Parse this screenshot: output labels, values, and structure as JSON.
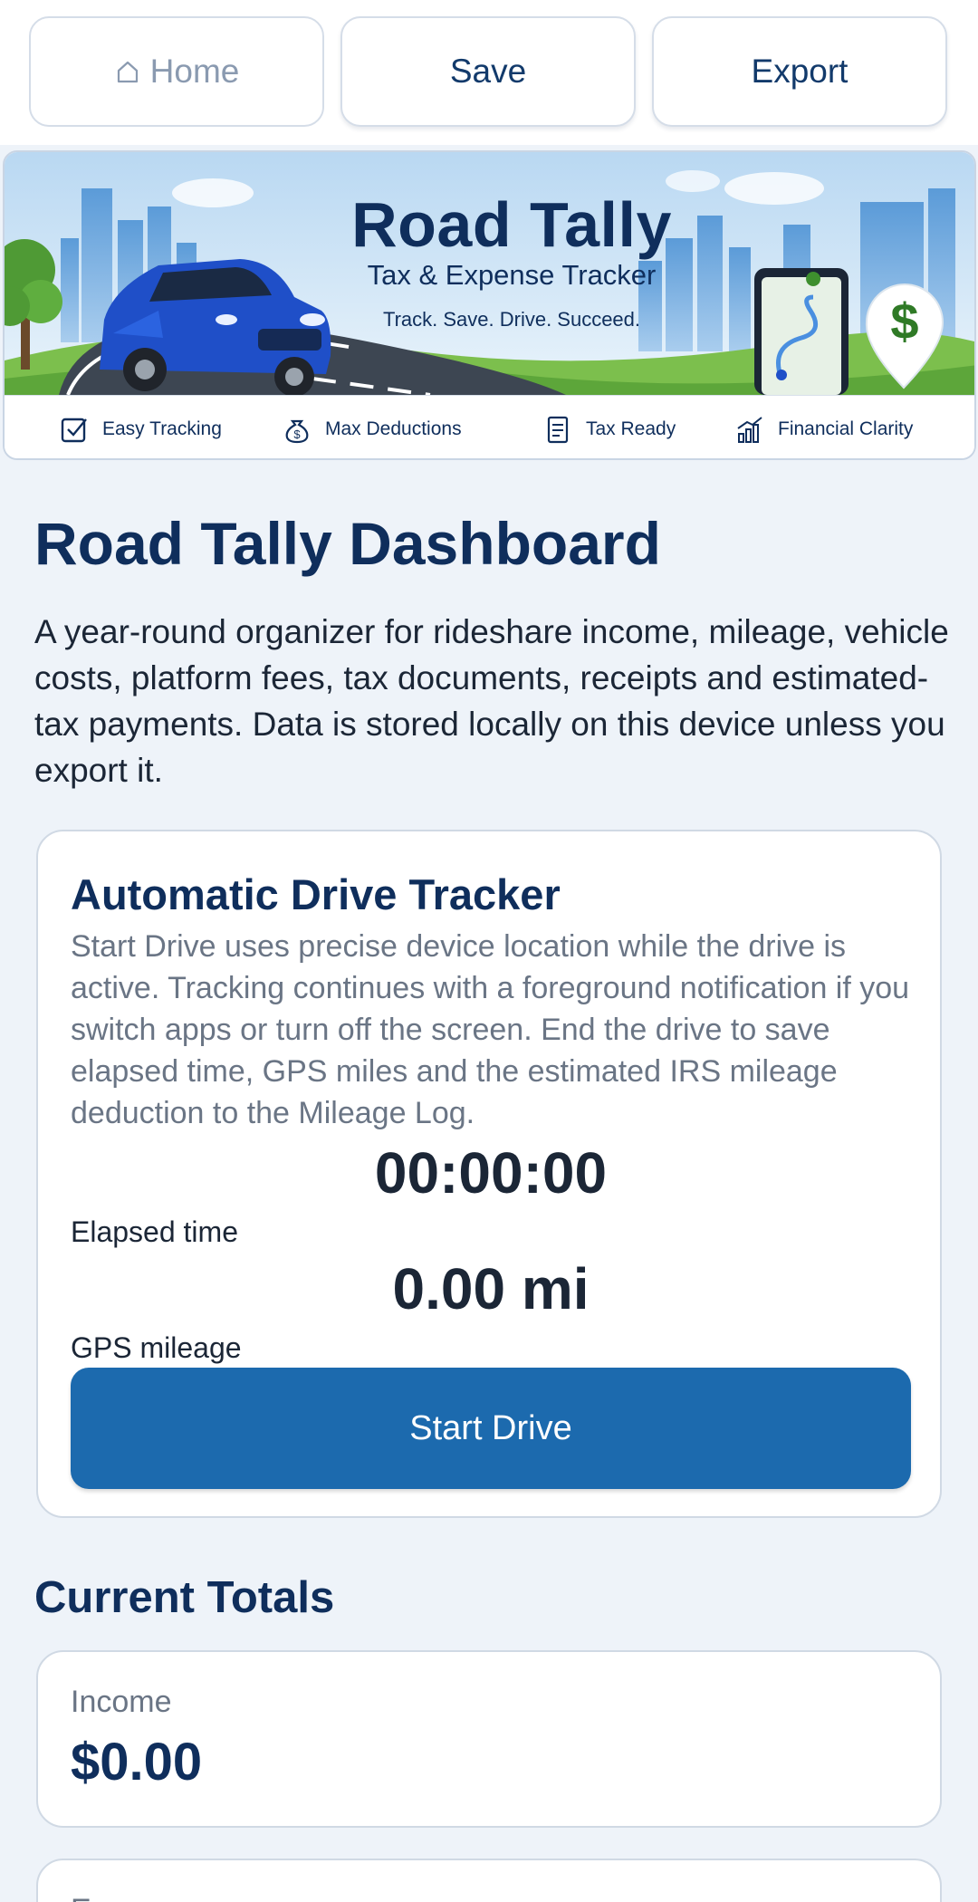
{
  "nav": {
    "home_label": "Home",
    "save_label": "Save",
    "export_label": "Export"
  },
  "banner": {
    "title": "Road Tally",
    "subtitle": "Tax & Expense Tracker",
    "tagline": "Track. Save. Drive. Succeed.",
    "features": [
      {
        "label": "Easy Tracking",
        "icon": "checkbox-icon"
      },
      {
        "label": "Max Deductions",
        "icon": "money-bag-icon"
      },
      {
        "label": "Tax Ready",
        "icon": "document-icon"
      },
      {
        "label": "Financial Clarity",
        "icon": "growth-chart-icon"
      }
    ],
    "pin_symbol": "$"
  },
  "page": {
    "title": "Road Tally Dashboard",
    "intro": "A year-round organizer for rideshare income, mileage, vehicle costs, platform fees, tax documents, receipts and estimated-tax payments. Data is stored locally on this device unless you export it."
  },
  "tracker": {
    "title": "Automatic Drive Tracker",
    "description": "Start Drive uses precise device location while the drive is active. Tracking continues with a foreground notification if you switch apps or turn off the screen. End the drive to save elapsed time, GPS miles and the estimated IRS mileage deduction to the Mileage Log.",
    "elapsed_value": "00:00:00",
    "elapsed_label": "Elapsed time",
    "miles_value": "0.00 mi",
    "miles_label": "GPS mileage",
    "start_label": "Start Drive"
  },
  "totals": {
    "title": "Current Totals",
    "items": [
      {
        "label": "Income",
        "value": "$0.00"
      },
      {
        "label": "E",
        "value": ""
      }
    ]
  },
  "colors": {
    "primary": "#1c6aae",
    "heading": "#0f2e5c",
    "background": "#eef3f9",
    "muted_text": "#6a7585"
  }
}
